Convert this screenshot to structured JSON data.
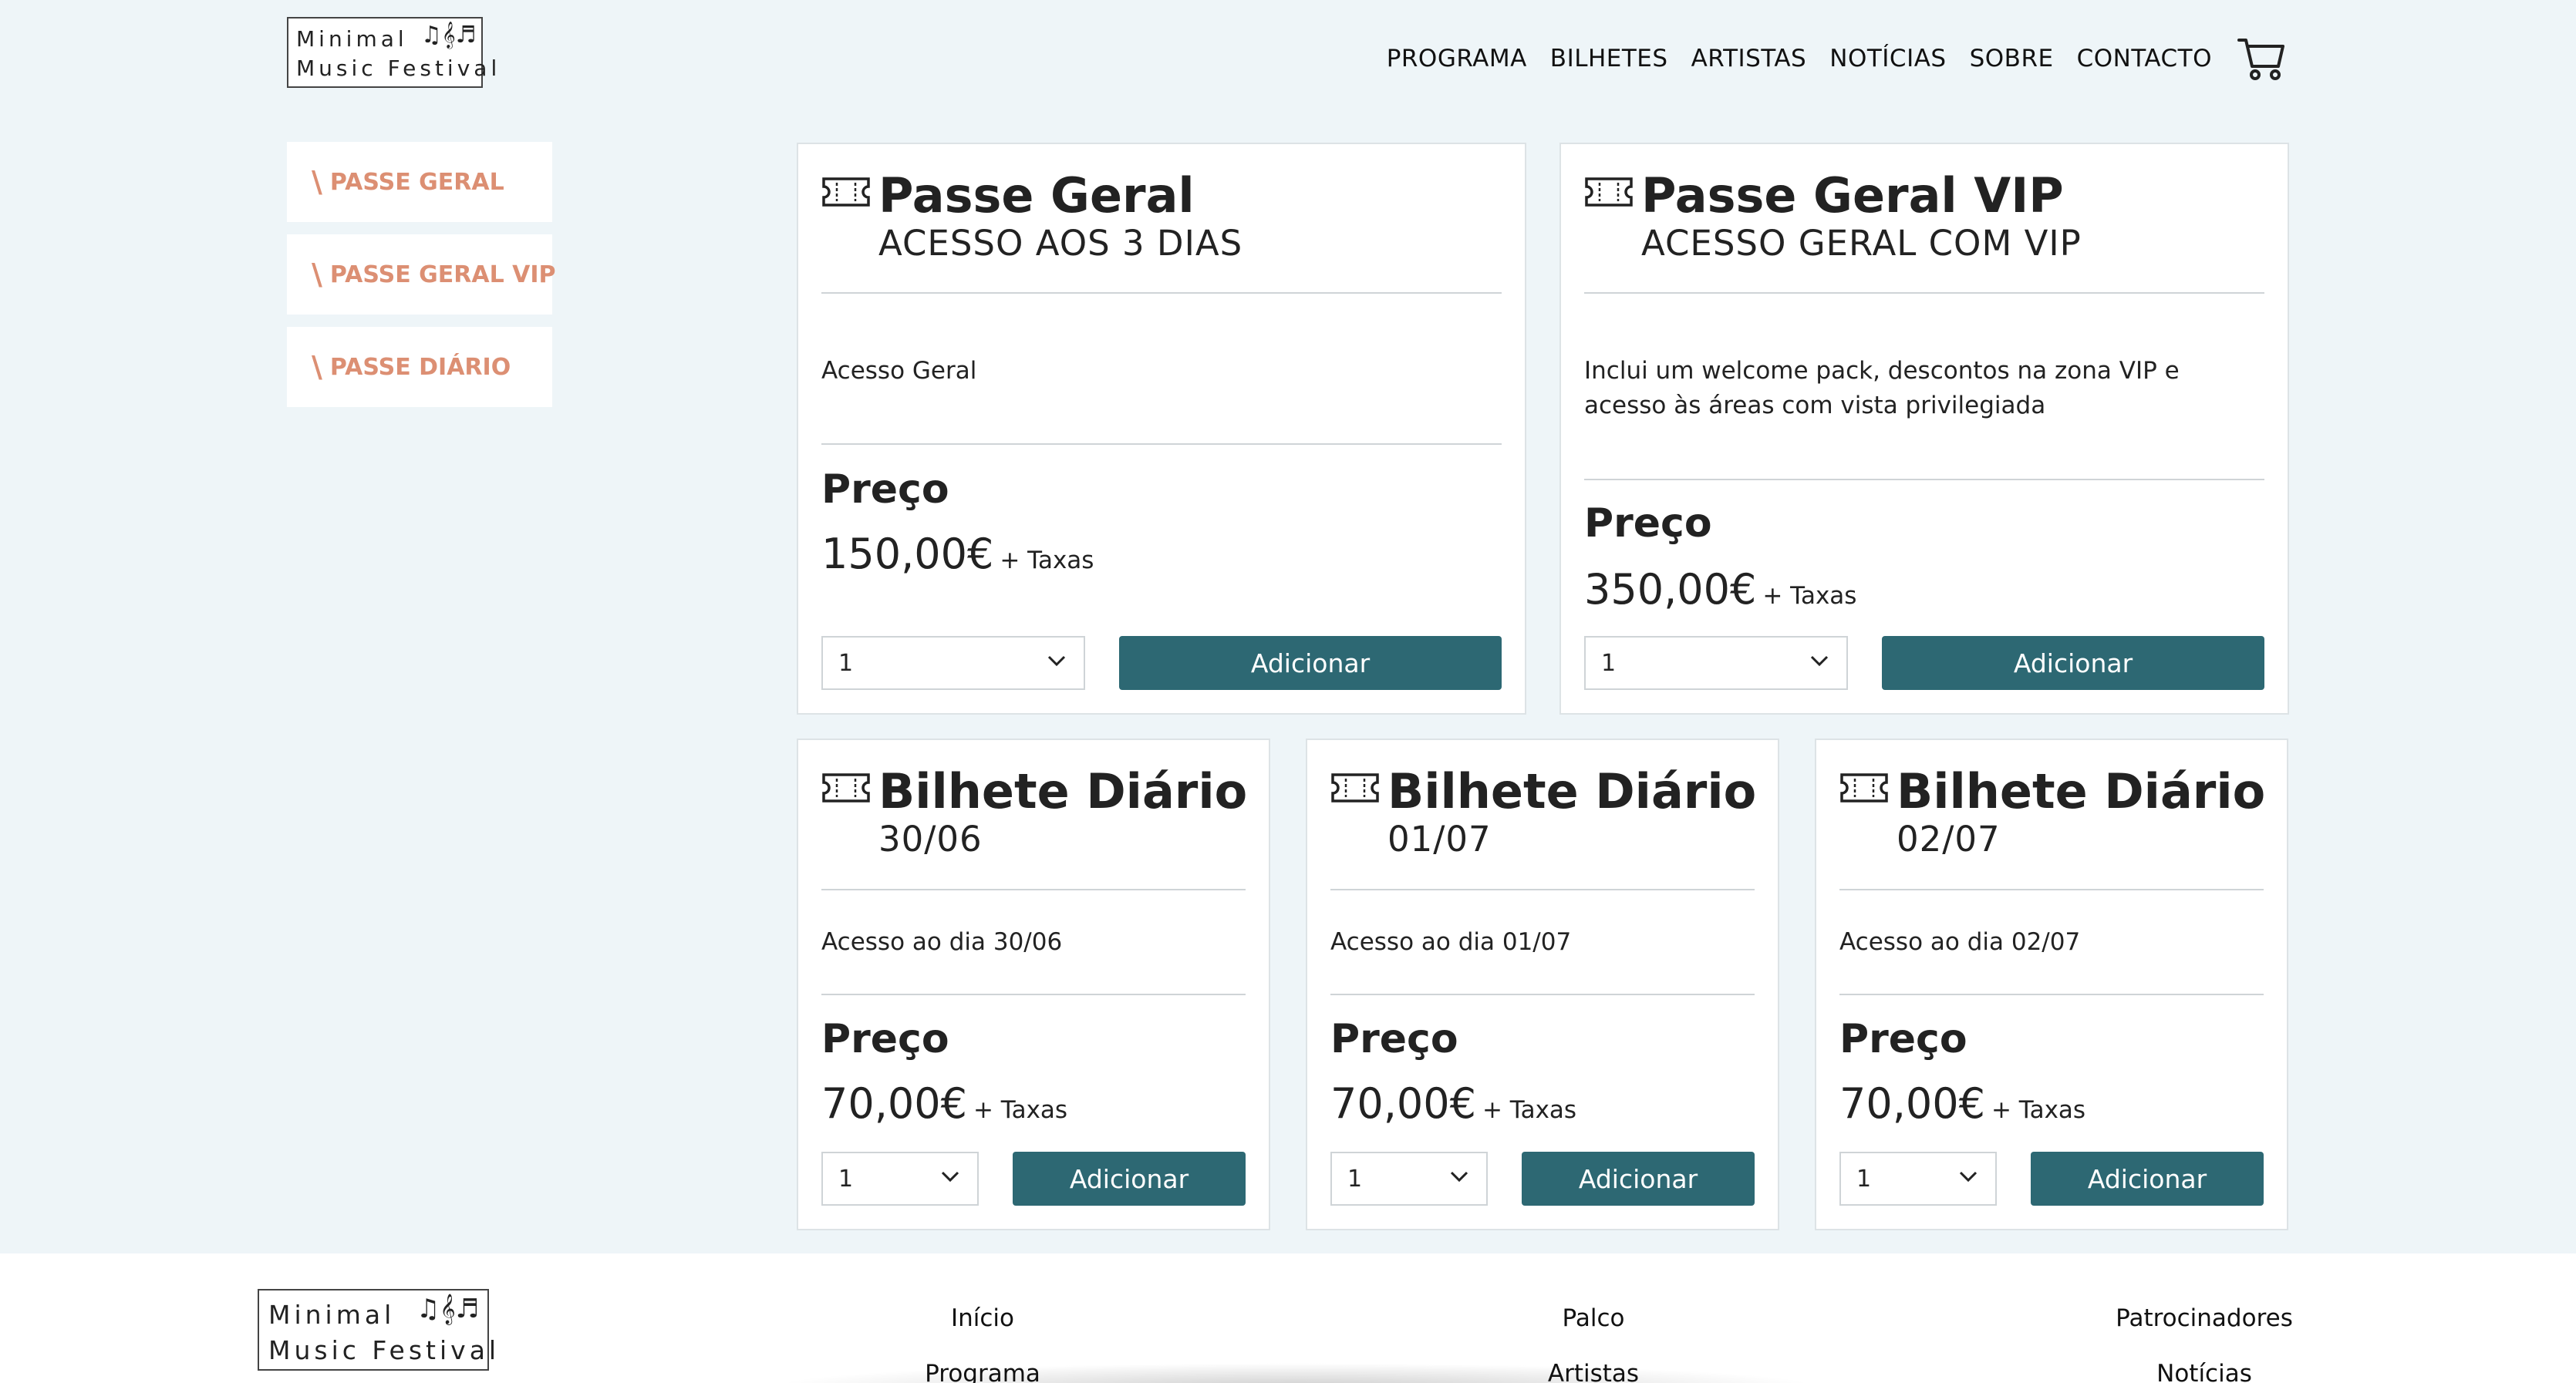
{
  "logo": {
    "line1": "Minimal",
    "line2": "Music Festival",
    "notes": "♫𝄞♬"
  },
  "nav": {
    "items": [
      "PROGRAMA",
      "BILHETES",
      "ARTISTAS",
      "NOTÍCIAS",
      "SOBRE",
      "CONTACTO"
    ],
    "cart_icon": "cart-icon"
  },
  "sidebar": {
    "items": [
      {
        "slash": "\\",
        "label": "PASSE GERAL"
      },
      {
        "slash": "\\",
        "label": "PASSE GERAL VIP"
      },
      {
        "slash": "\\",
        "label": "PASSE DIÁRIO"
      }
    ]
  },
  "colors": {
    "accent": "#2d6873",
    "sidebar_text": "#dc8f73",
    "background": "#eef5f8"
  },
  "tickets": [
    {
      "title": "Passe Geral",
      "subtitle": "ACESSO AOS 3 DIAS",
      "description": "Acesso Geral",
      "price_label": "Preço",
      "price": "150,00€",
      "tax": "+ Taxas",
      "qty": "1",
      "button": "Adicionar"
    },
    {
      "title": "Passe Geral VIP",
      "subtitle": "ACESSO GERAL COM VIP",
      "description": "Inclui um welcome pack, descontos na zona VIP e acesso às áreas com vista privilegiada",
      "price_label": "Preço",
      "price": "350,00€",
      "tax": "+ Taxas",
      "qty": "1",
      "button": "Adicionar"
    },
    {
      "title": "Bilhete Diário",
      "subtitle": "30/06",
      "description": "Acesso ao dia 30/06",
      "price_label": "Preço",
      "price": "70,00€",
      "tax": "+ Taxas",
      "qty": "1",
      "button": "Adicionar"
    },
    {
      "title": "Bilhete Diário",
      "subtitle": "01/07",
      "description": "Acesso ao dia 01/07",
      "price_label": "Preço",
      "price": "70,00€",
      "tax": "+ Taxas",
      "qty": "1",
      "button": "Adicionar"
    },
    {
      "title": "Bilhete Diário",
      "subtitle": "02/07",
      "description": "Acesso ao dia 02/07",
      "price_label": "Preço",
      "price": "70,00€",
      "tax": "+ Taxas",
      "qty": "1",
      "button": "Adicionar"
    }
  ],
  "footer": {
    "links": [
      "Início",
      "Programa",
      "Palco",
      "Artistas",
      "Patrocinadores",
      "Notícias"
    ]
  }
}
